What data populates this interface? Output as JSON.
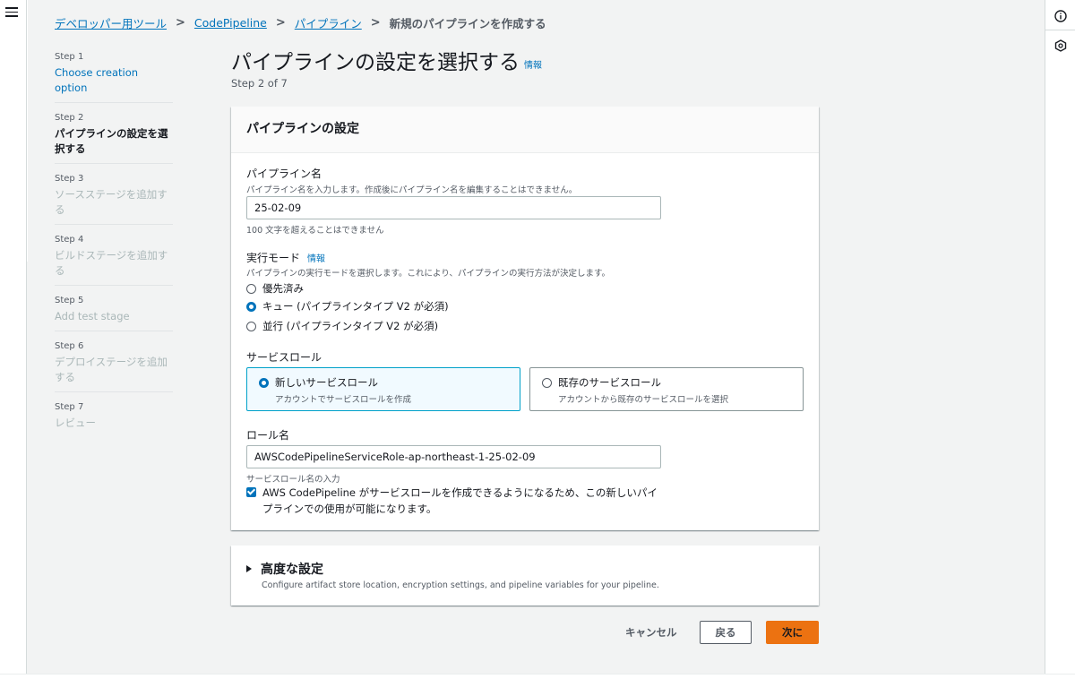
{
  "breadcrumb": [
    {
      "label": "デベロッパー用ツール"
    },
    {
      "label": "CodePipeline"
    },
    {
      "label": "パイプライン"
    }
  ],
  "breadcrumb_current": "新規のパイプラインを作成する",
  "steps": [
    {
      "num": "Step 1",
      "label": "Choose creation option",
      "state": "link"
    },
    {
      "num": "Step 2",
      "label": "パイプラインの設定を選択する",
      "state": "active"
    },
    {
      "num": "Step 3",
      "label": "ソースステージを追加する",
      "state": "disabled"
    },
    {
      "num": "Step 4",
      "label": "ビルドステージを追加する",
      "state": "disabled"
    },
    {
      "num": "Step 5",
      "label": "Add test stage",
      "state": "disabled"
    },
    {
      "num": "Step 6",
      "label": "デプロイステージを追加する",
      "state": "disabled"
    },
    {
      "num": "Step 7",
      "label": "レビュー",
      "state": "disabled"
    }
  ],
  "page": {
    "title": "パイプラインの設定を選択する",
    "info": "情報",
    "step_count": "Step 2 of 7"
  },
  "settings": {
    "header": "パイプラインの設定",
    "name_label": "パイプライン名",
    "name_desc": "パイプライン名を入力します。作成後にパイプライン名を編集することはできません。",
    "name_value": "25-02-09",
    "name_constraint": "100 文字を超えることはできません",
    "mode_label": "実行モード",
    "mode_info": "情報",
    "mode_desc": "パイプラインの実行モードを選択します。これにより、パイプラインの実行方法が決定します。",
    "modes": [
      {
        "label": "優先済み",
        "checked": false
      },
      {
        "label": "キュー (パイプラインタイプ V2 が必須)",
        "checked": true
      },
      {
        "label": "並行 (パイプラインタイプ V2 が必須)",
        "checked": false
      }
    ],
    "role_section_label": "サービスロール",
    "role_new_title": "新しいサービスロール",
    "role_new_desc": "アカウントでサービスロールを作成",
    "role_existing_title": "既存のサービスロール",
    "role_existing_desc": "アカウントから既存のサービスロールを選択",
    "role_name_label": "ロール名",
    "role_name_value": "AWSCodePipelineServiceRole-ap-northeast-1-25-02-09",
    "role_name_hint": "サービスロール名の入力",
    "checkbox_text": "AWS CodePipeline がサービスロールを作成できるようになるため、この新しいパイプラインでの使用が可能になります。"
  },
  "advanced": {
    "title": "高度な設定",
    "desc": "Configure artifact store location, encryption settings, and pipeline variables for your pipeline."
  },
  "actions": {
    "cancel": "キャンセル",
    "back": "戻る",
    "next": "次に"
  },
  "colors": {
    "link": "#0073bb",
    "primary_button": "#ec7211",
    "selected_tile_border": "#00a1c9"
  }
}
